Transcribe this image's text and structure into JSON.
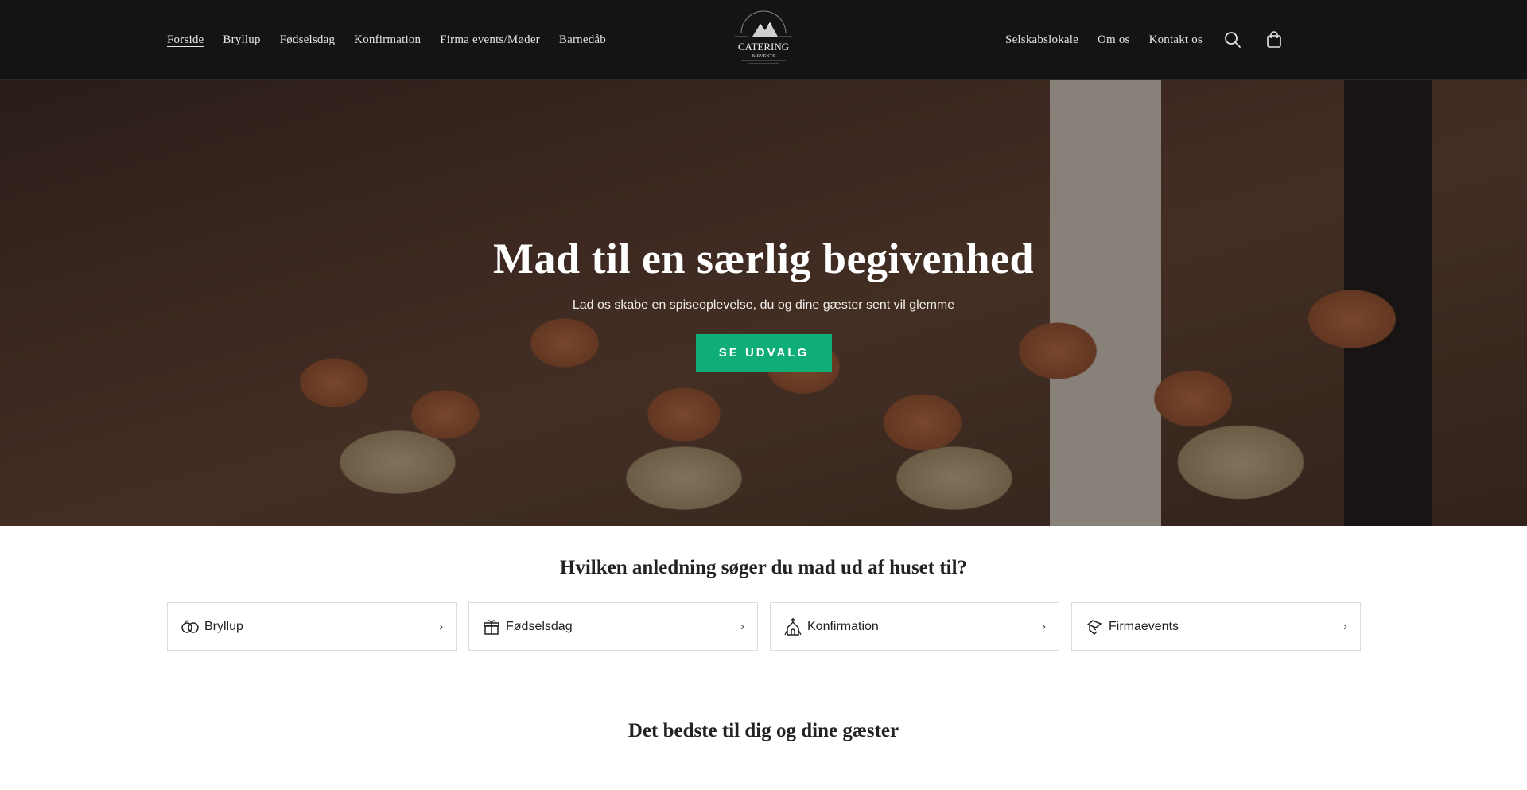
{
  "header": {
    "nav_left": [
      {
        "label": "Forside",
        "active": true
      },
      {
        "label": "Bryllup"
      },
      {
        "label": "Fødselsdag"
      },
      {
        "label": "Konfirmation"
      },
      {
        "label": "Firma events/Møder"
      },
      {
        "label": "Barnedåb"
      }
    ],
    "nav_right": [
      {
        "label": "Selskabslokale"
      },
      {
        "label": "Om os"
      },
      {
        "label": "Kontakt os"
      }
    ],
    "logo": {
      "main": "CATERING",
      "sub": "& EVENTS"
    },
    "icons": [
      "search-icon",
      "cart-icon"
    ]
  },
  "hero": {
    "title": "Mad til en særlig begivenhed",
    "subtitle": "Lad os skabe en spiseoplevelse, du og dine gæster sent vil glemme",
    "button_label": "SE UDVALG",
    "button_color": "#0fae77"
  },
  "occasions": {
    "title": "Hvilken anledning søger du mad ud af huset til?",
    "items": [
      {
        "label": "Bryllup",
        "icon": "rings-icon"
      },
      {
        "label": "Fødselsdag",
        "icon": "gift-icon"
      },
      {
        "label": "Konfirmation",
        "icon": "church-icon"
      },
      {
        "label": "Firmaevents",
        "icon": "handshake-icon"
      }
    ],
    "chevron": "›"
  },
  "best": {
    "title": "Det bedste til dig og dine gæster"
  }
}
